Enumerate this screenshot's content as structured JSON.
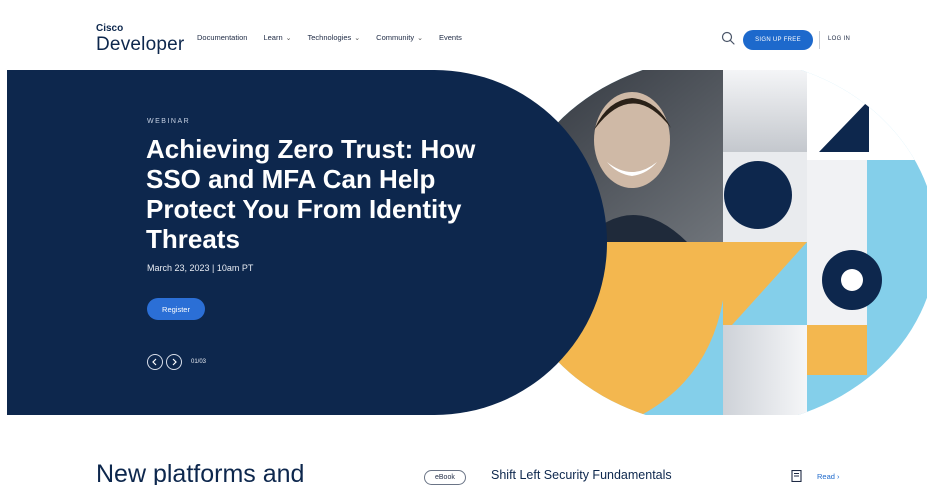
{
  "header": {
    "logo_small": "Cisco",
    "logo_large": "Developer",
    "nav": [
      {
        "label": "Documentation",
        "dropdown": false
      },
      {
        "label": "Learn",
        "dropdown": true
      },
      {
        "label": "Technologies",
        "dropdown": true
      },
      {
        "label": "Community",
        "dropdown": true
      },
      {
        "label": "Events",
        "dropdown": false
      }
    ],
    "signup_label": "SIGN UP FREE",
    "login_label": "LOG IN"
  },
  "hero": {
    "eyebrow": "WEBINAR",
    "title": "Achieving Zero Trust: How SSO and MFA Can Help Protect You From Identity Threats",
    "date": "March 23, 2023 | 10am PT",
    "register_label": "Register",
    "counter": "01/03"
  },
  "lower": {
    "heading": "New platforms and",
    "badge": "eBook",
    "title": "Shift Left Security Fundamentals",
    "read_label": "Read"
  },
  "colors": {
    "navy": "#0d274d",
    "blue": "#1d69cc",
    "gold": "#f3b74f",
    "sky": "#84cfea"
  }
}
